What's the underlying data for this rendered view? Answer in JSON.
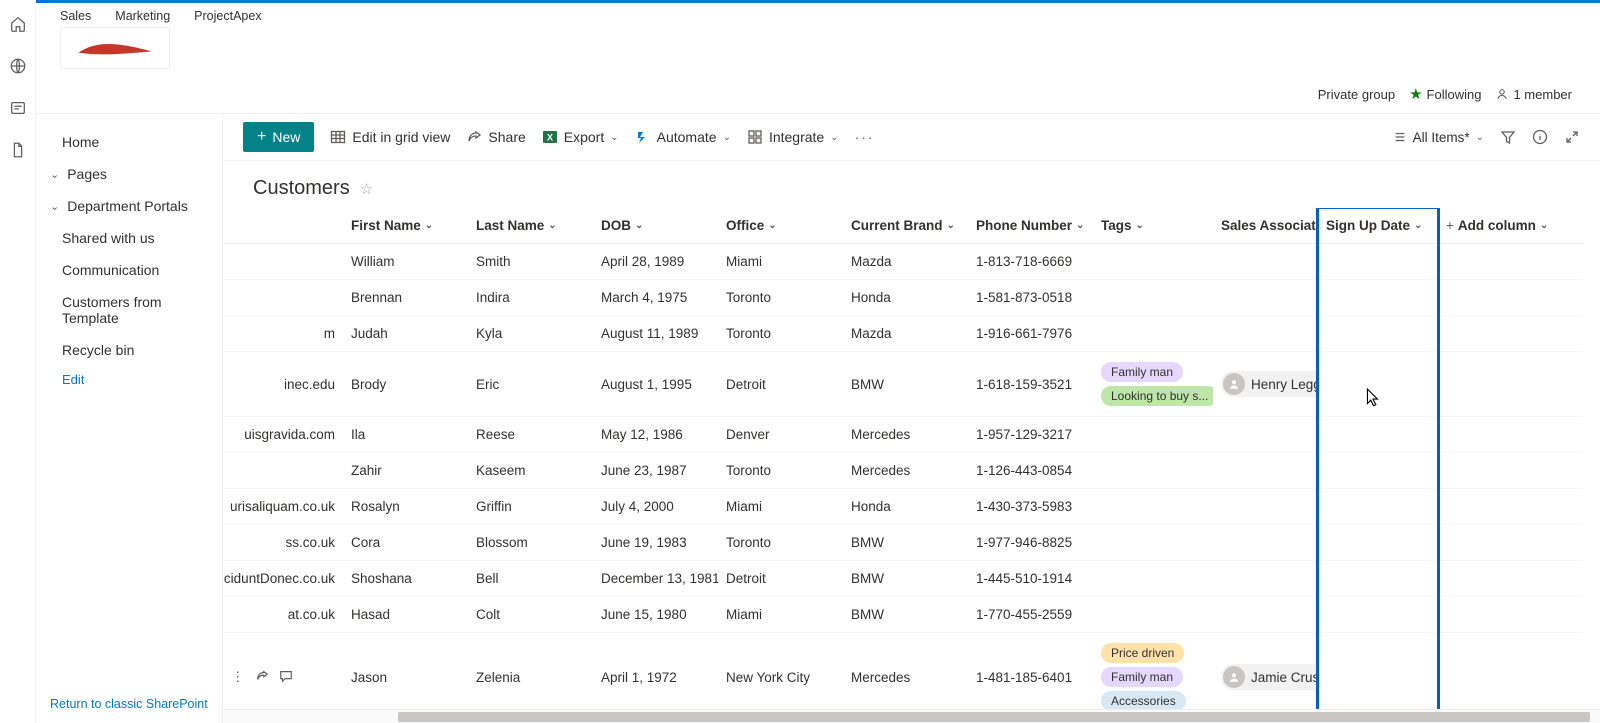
{
  "header": {
    "tabs": [
      "Sales",
      "Marketing",
      "ProjectApex"
    ],
    "privateGroup": "Private group",
    "following": "Following",
    "members": "1 member"
  },
  "nav": {
    "home": "Home",
    "pages": "Pages",
    "dept": "Department Portals",
    "shared": "Shared with us",
    "comm": "Communication",
    "cust": "Customers from Template",
    "recycle": "Recycle bin",
    "edit": "Edit",
    "return": "Return to classic SharePoint"
  },
  "commands": {
    "new": "New",
    "editGrid": "Edit in grid view",
    "share": "Share",
    "export": "Export",
    "automate": "Automate",
    "integrate": "Integrate",
    "viewName": "All Items*"
  },
  "list": {
    "title": "Customers"
  },
  "columns": {
    "first": "First Name",
    "last": "Last Name",
    "dob": "DOB",
    "office": "Office",
    "brand": "Current Brand",
    "phone": "Phone Number",
    "tags": "Tags",
    "assoc": "Sales Associate",
    "signup": "Sign Up Date",
    "add": "Add column"
  },
  "tagColors": {
    "Family man": "#e6d7ff",
    "Looking to buy s...": "#bde6a8",
    "Price driven": "#ffe2a8",
    "Accessories": "#d8e8f5"
  },
  "rows": [
    {
      "email": "",
      "first": "William",
      "last": "Smith",
      "dob": "April 28, 1989",
      "office": "Miami",
      "brand": "Mazda",
      "phone": "1-813-718-6669",
      "tags": [],
      "assoc": ""
    },
    {
      "email": "",
      "first": "Brennan",
      "last": "Indira",
      "dob": "March 4, 1975",
      "office": "Toronto",
      "brand": "Honda",
      "phone": "1-581-873-0518",
      "tags": [],
      "assoc": ""
    },
    {
      "email": "m",
      "first": "Judah",
      "last": "Kyla",
      "dob": "August 11, 1989",
      "office": "Toronto",
      "brand": "Mazda",
      "phone": "1-916-661-7976",
      "tags": [],
      "assoc": ""
    },
    {
      "email": "inec.edu",
      "first": "Brody",
      "last": "Eric",
      "dob": "August 1, 1995",
      "office": "Detroit",
      "brand": "BMW",
      "phone": "1-618-159-3521",
      "tags": [
        "Family man",
        "Looking to buy s..."
      ],
      "assoc": "Henry Legge"
    },
    {
      "email": "uisgravida.com",
      "first": "Ila",
      "last": "Reese",
      "dob": "May 12, 1986",
      "office": "Denver",
      "brand": "Mercedes",
      "phone": "1-957-129-3217",
      "tags": [],
      "assoc": ""
    },
    {
      "email": "",
      "first": "Zahir",
      "last": "Kaseem",
      "dob": "June 23, 1987",
      "office": "Toronto",
      "brand": "Mercedes",
      "phone": "1-126-443-0854",
      "tags": [],
      "assoc": ""
    },
    {
      "email": "urisaliquam.co.uk",
      "first": "Rosalyn",
      "last": "Griffin",
      "dob": "July 4, 2000",
      "office": "Miami",
      "brand": "Honda",
      "phone": "1-430-373-5983",
      "tags": [],
      "assoc": ""
    },
    {
      "email": "ss.co.uk",
      "first": "Cora",
      "last": "Blossom",
      "dob": "June 19, 1983",
      "office": "Toronto",
      "brand": "BMW",
      "phone": "1-977-946-8825",
      "tags": [],
      "assoc": ""
    },
    {
      "email": "inciduntDonec.co.uk",
      "first": "Shoshana",
      "last": "Bell",
      "dob": "December 13, 1981",
      "office": "Detroit",
      "brand": "BMW",
      "phone": "1-445-510-1914",
      "tags": [],
      "assoc": ""
    },
    {
      "email": "at.co.uk",
      "first": "Hasad",
      "last": "Colt",
      "dob": "June 15, 1980",
      "office": "Miami",
      "brand": "BMW",
      "phone": "1-770-455-2559",
      "tags": [],
      "assoc": ""
    },
    {
      "email": "",
      "first": "Jason",
      "last": "Zelenia",
      "dob": "April 1, 1972",
      "office": "New York City",
      "brand": "Mercedes",
      "phone": "1-481-185-6401",
      "tags": [
        "Price driven",
        "Family man",
        "Accessories"
      ],
      "assoc": "Jamie Crust",
      "showActions": true
    }
  ]
}
